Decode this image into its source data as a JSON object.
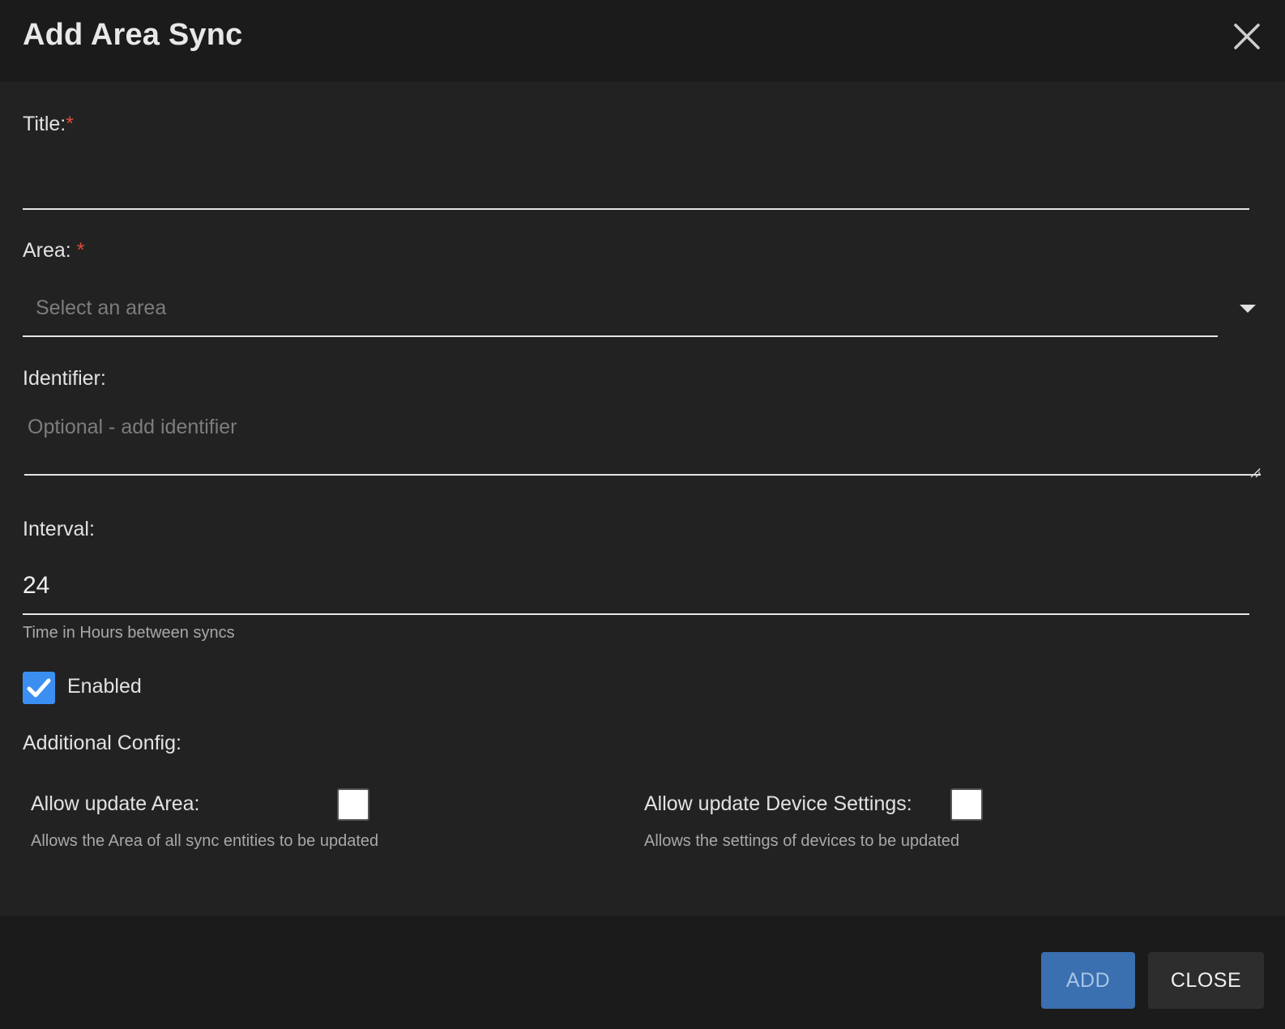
{
  "dialog": {
    "title": "Add Area Sync",
    "close_icon": "close-icon"
  },
  "form": {
    "title_field": {
      "label": "Title:",
      "required_mark": "*",
      "value": ""
    },
    "area_field": {
      "label": "Area:",
      "required_mark": "*",
      "placeholder": "Select an area",
      "icon": "chevron-down-icon"
    },
    "identifier_field": {
      "label": "Identifier:",
      "placeholder": "Optional - add identifier",
      "value": ""
    },
    "interval_field": {
      "label": "Interval:",
      "value": "24",
      "hint": "Time in Hours between syncs"
    },
    "enabled": {
      "label": "Enabled",
      "checked": true
    },
    "additional_config": {
      "label": "Additional Config:",
      "options": [
        {
          "label": "Allow update Area:",
          "description": "Allows the Area of all sync entities to be updated",
          "checked": false
        },
        {
          "label": "Allow update Device Settings:",
          "description": "Allows the settings of devices to be updated",
          "checked": false
        }
      ]
    }
  },
  "footer": {
    "add_label": "ADD",
    "close_label": "CLOSE"
  },
  "colors": {
    "accent": "#3b8ff2",
    "add_button": "#3a6fb0",
    "required": "#e04a3a",
    "header_bg": "#1b1b1b",
    "body_bg": "#222222"
  }
}
